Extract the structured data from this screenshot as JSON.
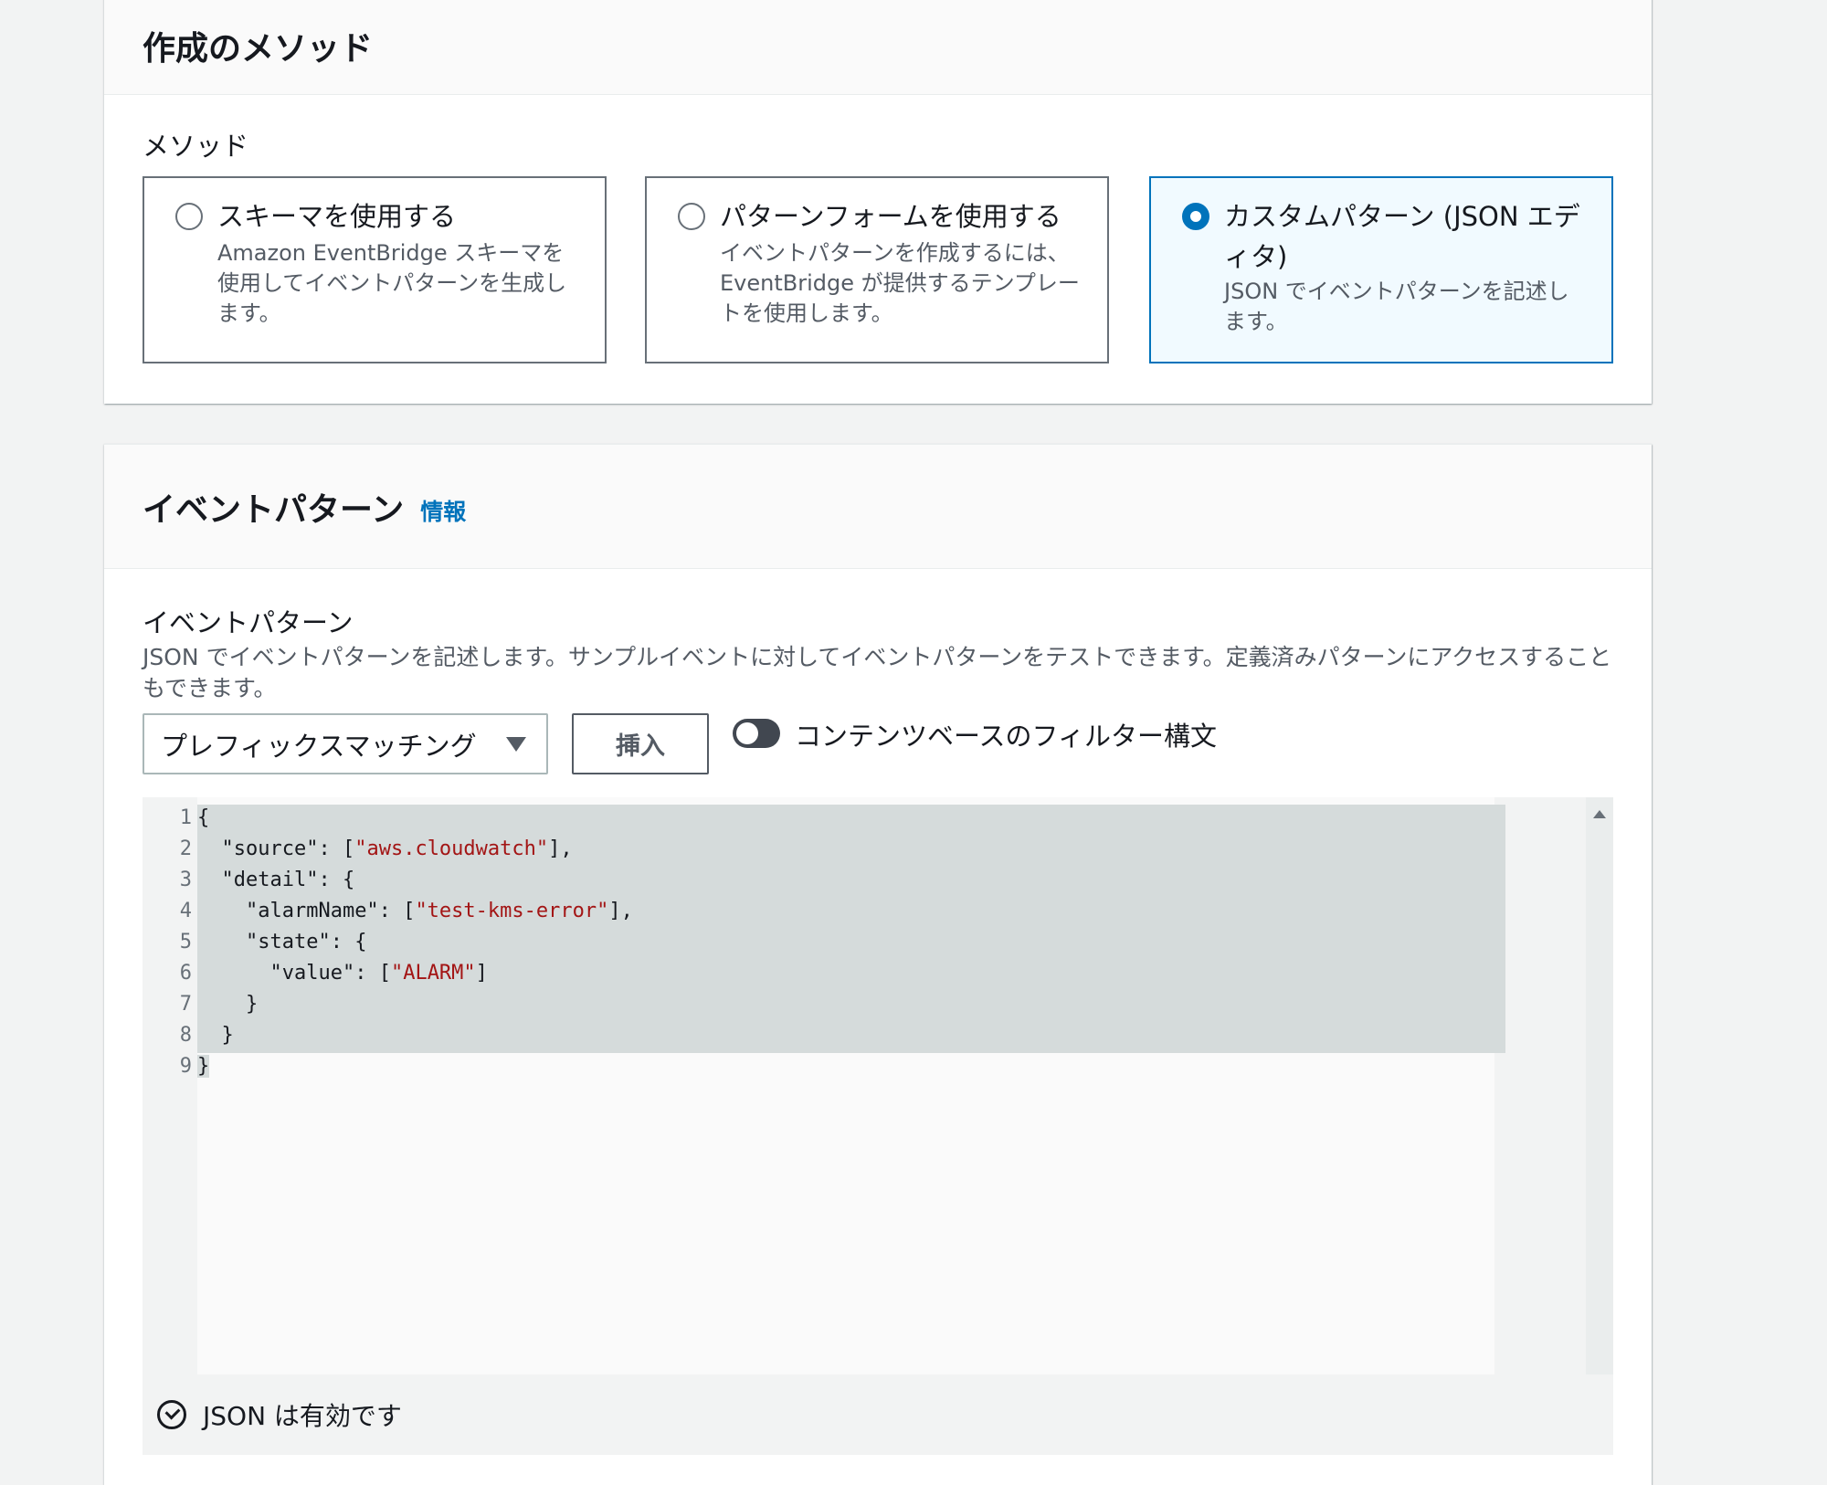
{
  "method_section": {
    "title": "作成のメソッド",
    "field_label": "メソッド",
    "options": [
      {
        "title": "スキーマを使用する",
        "description": "Amazon EventBridge スキーマを使用してイベントパターンを生成します。",
        "selected": false
      },
      {
        "title": "パターンフォームを使用する",
        "description": "イベントパターンを作成するには、EventBridge が提供するテンプレートを使用します。",
        "selected": false
      },
      {
        "title": "カスタムパターン (JSON エディタ)",
        "description": "JSON でイベントパターンを記述します。",
        "selected": true
      }
    ]
  },
  "pattern_section": {
    "title": "イベントパターン",
    "info_link": "情報",
    "field_label": "イベントパターン",
    "description": "JSON でイベントパターンを記述します。サンプルイベントに対してイベントパターンをテストできます。定義済みパターンにアクセスすることもできます。",
    "select_value": "プレフィックスマッチング",
    "insert_button": "挿入",
    "toggle_label": "コンテンツベースのフィルター構文",
    "toggle_on": false
  },
  "editor": {
    "line_numbers": [
      "1",
      "2",
      "3",
      "4",
      "5",
      "6",
      "7",
      "8",
      "9"
    ],
    "lines": [
      "{",
      "  \"source\": [\"aws.cloudwatch\"],",
      "  \"detail\": {",
      "    \"alarmName\": [\"test-kms-error\"],",
      "    \"state\": {",
      "      \"value\": [\"ALARM\"]",
      "    }",
      "  }",
      "}"
    ],
    "status": "JSON は有効です"
  },
  "colors": {
    "accent": "#0073bb",
    "selected_tile_bg": "#f1faff",
    "string": "#a31515",
    "selection": "#d5dbdb"
  }
}
